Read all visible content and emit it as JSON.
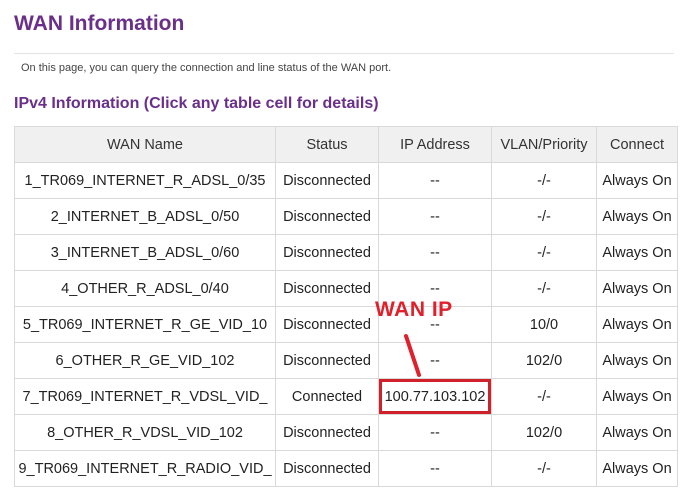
{
  "header": {
    "title": "WAN Information",
    "description": "On this page, you can query the connection and line status of the WAN port."
  },
  "section": {
    "title": "IPv4 Information (Click any table cell for details)"
  },
  "table": {
    "columns": [
      "WAN Name",
      "Status",
      "IP Address",
      "VLAN/Priority",
      "Connect"
    ],
    "rows": [
      [
        "1_TR069_INTERNET_R_ADSL_0/35",
        "Disconnected",
        "--",
        "-/-",
        "Always On"
      ],
      [
        "2_INTERNET_B_ADSL_0/50",
        "Disconnected",
        "--",
        "-/-",
        "Always On"
      ],
      [
        "3_INTERNET_B_ADSL_0/60",
        "Disconnected",
        "--",
        "-/-",
        "Always On"
      ],
      [
        "4_OTHER_R_ADSL_0/40",
        "Disconnected",
        "--",
        "-/-",
        "Always On"
      ],
      [
        "5_TR069_INTERNET_R_GE_VID_10",
        "Disconnected",
        "--",
        "10/0",
        "Always On"
      ],
      [
        "6_OTHER_R_GE_VID_102",
        "Disconnected",
        "--",
        "102/0",
        "Always On"
      ],
      [
        "7_TR069_INTERNET_R_VDSL_VID_",
        "Connected",
        "100.77.103.102",
        "-/-",
        "Always On"
      ],
      [
        "8_OTHER_R_VDSL_VID_102",
        "Disconnected",
        "--",
        "102/0",
        "Always On"
      ],
      [
        "9_TR069_INTERNET_R_RADIO_VID_",
        "Disconnected",
        "--",
        "-/-",
        "Always On"
      ]
    ]
  },
  "annotation": {
    "label": "WAN IP",
    "color": "#e0202a"
  },
  "colors": {
    "accent": "#6a2f8a",
    "highlight": "#d0202a"
  }
}
